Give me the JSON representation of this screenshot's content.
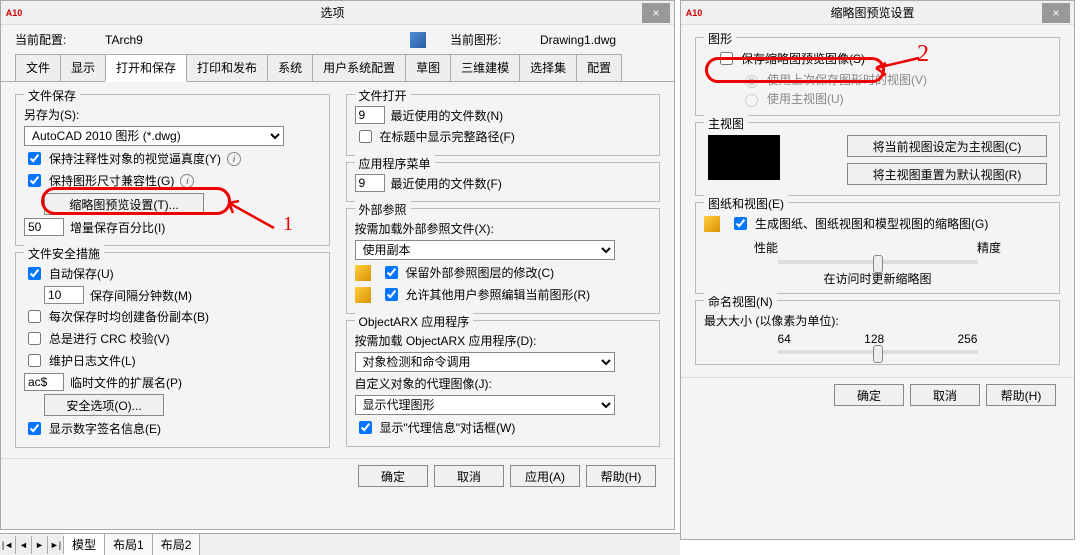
{
  "win1": {
    "app_icon": "A10",
    "title": "选项",
    "header": {
      "profile_lbl": "当前配置:",
      "profile_val": "TArch9",
      "drawing_lbl": "当前图形:",
      "drawing_val": "Drawing1.dwg"
    },
    "tabs": [
      "文件",
      "显示",
      "打开和保存",
      "打印和发布",
      "系统",
      "用户系统配置",
      "草图",
      "三维建模",
      "选择集",
      "配置"
    ],
    "active_tab": 2,
    "left": {
      "save_group": "文件保存",
      "save_as": "另存为(S):",
      "save_as_val": "AutoCAD 2010 图形 (*.dwg)",
      "cb1": "保持注释性对象的视觉逼真度(Y)",
      "cb2": "保持图形尺寸兼容性(G)",
      "thumb_btn": "缩略图预览设置(T)...",
      "inc_val": "50",
      "inc_lbl": "增量保存百分比(I)",
      "safety_group": "文件安全措施",
      "auto_save": "自动保存(U)",
      "auto_save_val": "10",
      "auto_save_lbl": "保存间隔分钟数(M)",
      "cb_backup": "每次保存时均创建备份副本(B)",
      "cb_crc": "总是进行 CRC 校验(V)",
      "cb_log": "维护日志文件(L)",
      "ext_val": "ac$",
      "ext_lbl": "临时文件的扩展名(P)",
      "sec_btn": "安全选项(O)...",
      "cb_sig": "显示数字签名信息(E)"
    },
    "right": {
      "open_group": "文件打开",
      "recent_val": "9",
      "recent_lbl": "最近使用的文件数(N)",
      "cb_title": "在标题中显示完整路径(F)",
      "menu_group": "应用程序菜单",
      "menu_val": "9",
      "menu_lbl": "最近使用的文件数(F)",
      "xref_group": "外部参照",
      "xref_lbl": "按需加载外部参照文件(X):",
      "xref_val": "使用副本",
      "cb_layer": "保留外部参照图层的修改(C)",
      "cb_edit": "允许其他用户参照编辑当前图形(R)",
      "arx_group": "ObjectARX 应用程序",
      "arx_lbl": "按需加载 ObjectARX 应用程序(D):",
      "arx_val": "对象检测和命令调用",
      "proxy_lbl": "自定义对象的代理图像(J):",
      "proxy_val": "显示代理图形",
      "cb_proxy": "显示\"代理信息\"对话框(W)"
    },
    "buttons": {
      "ok": "确定",
      "cancel": "取消",
      "apply": "应用(A)",
      "help": "帮助(H)"
    }
  },
  "win2": {
    "app_icon": "A10",
    "title": "缩略图预览设置",
    "g1": "图形",
    "cb_save": "保存缩略图预览图像(S)",
    "rb1": "使用上次保存图形时的视图(V)",
    "rb2": "使用主视图(U)",
    "g2": "主视图",
    "btn_home1": "将当前视图设定为主视图(C)",
    "btn_home2": "将主视图重置为默认视图(R)",
    "g3": "图纸和视图(E)",
    "cb_gen": "生成图纸、图纸视图和模型视图的缩略图(G)",
    "perf": "性能",
    "prec": "精度",
    "update_lbl": "在访问时更新缩略图",
    "g4": "命名视图(N)",
    "size_lbl": "最大大小 (以像素为单位):",
    "t64": "64",
    "t128": "128",
    "t256": "256",
    "buttons": {
      "ok": "确定",
      "cancel": "取消",
      "help": "帮助(H)"
    }
  },
  "status": {
    "tabs": [
      "模型",
      "布局1",
      "布局2"
    ]
  },
  "ann": {
    "one": "1",
    "two": "2"
  }
}
